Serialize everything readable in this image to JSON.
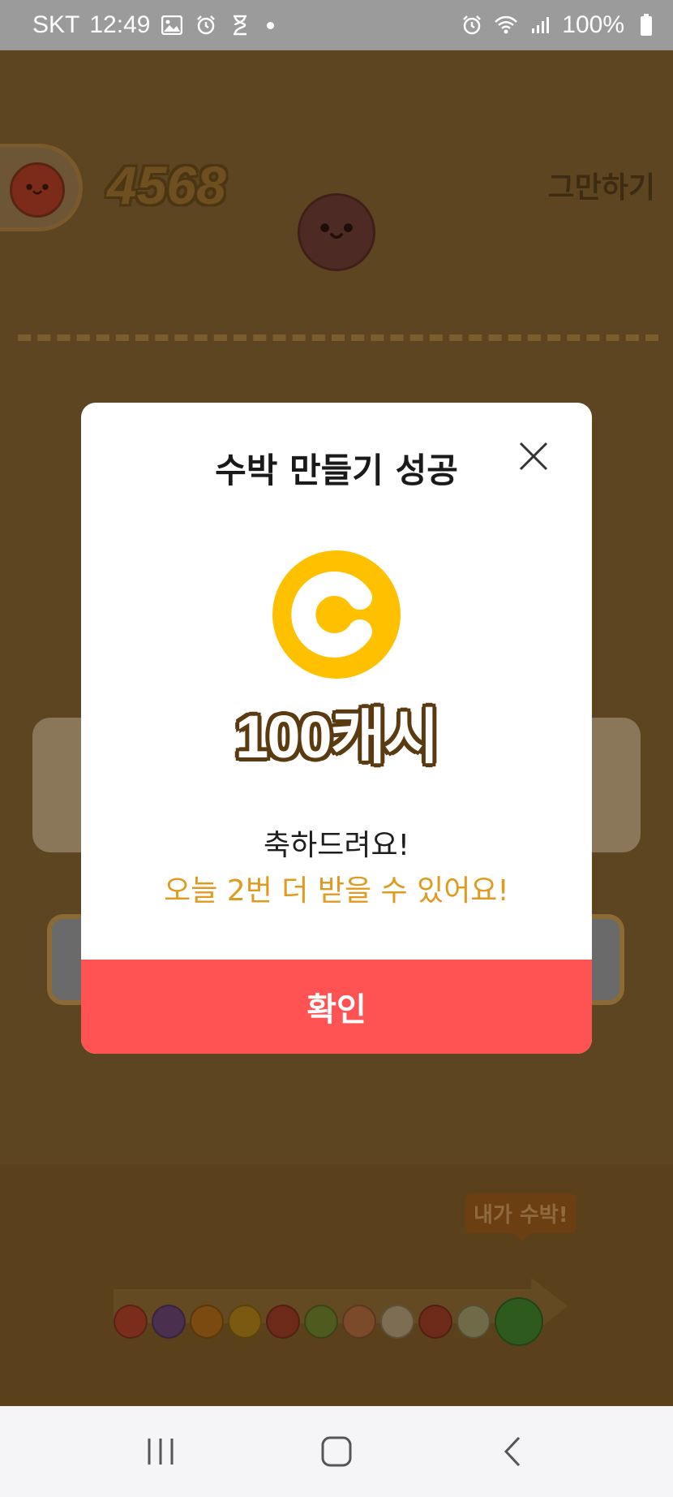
{
  "status_bar": {
    "carrier": "SKT",
    "time": "12:49",
    "battery": "100%",
    "left_icons": [
      "image-icon",
      "alarm-icon",
      "hourglass-icon",
      "dot-icon"
    ],
    "right_icons": [
      "alarm-icon",
      "wifi-icon",
      "signal-icon",
      "battery-icon"
    ]
  },
  "game": {
    "score": "4568",
    "quit_label": "그만하기",
    "bubble_tag": "내가 수박!",
    "fruit_chain_colors": [
      "#7a2d1b",
      "#4b2f4f",
      "#7a4a10",
      "#7a5a10",
      "#6e2a18",
      "#4f5a1e",
      "#7a4a2a",
      "#7d6d52",
      "#6e2a18",
      "#6f6a48",
      "#2f5a1e"
    ]
  },
  "modal": {
    "title": "수박 만들기 성공",
    "reward": "100캐시",
    "message": "축하드려요!",
    "remaining": "오늘 2번 더 받을 수 있어요!",
    "confirm_label": "확인",
    "colors": {
      "coin": "#ffc000",
      "remaining_text": "#e09a1f",
      "confirm_button": "#ff5353"
    }
  },
  "nav_bar": {
    "buttons": [
      "recents-icon",
      "home-icon",
      "back-icon"
    ]
  }
}
